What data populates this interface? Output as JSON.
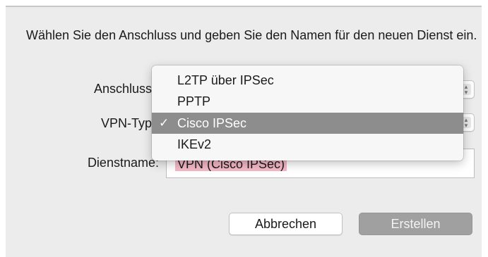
{
  "dialog": {
    "prompt": "Wählen Sie den Anschluss und geben Sie den Namen für den neuen Dienst ein.",
    "interface_label": "Anschluss:",
    "vpn_type_label": "VPN-Typ:",
    "service_name_label": "Dienstname:",
    "service_name_value": "VPN (Cisco IPSec)",
    "cancel_label": "Abbrechen",
    "create_label": "Erstellen"
  },
  "vpn_menu": {
    "items": [
      {
        "label": "L2TP über IPSec",
        "checked": false
      },
      {
        "label": "PPTP",
        "checked": false
      },
      {
        "label": "Cisco IPSec",
        "checked": true
      },
      {
        "label": "IKEv2",
        "checked": false
      }
    ],
    "check_glyph": "✓",
    "highlight_color": "#8d8d8d"
  }
}
